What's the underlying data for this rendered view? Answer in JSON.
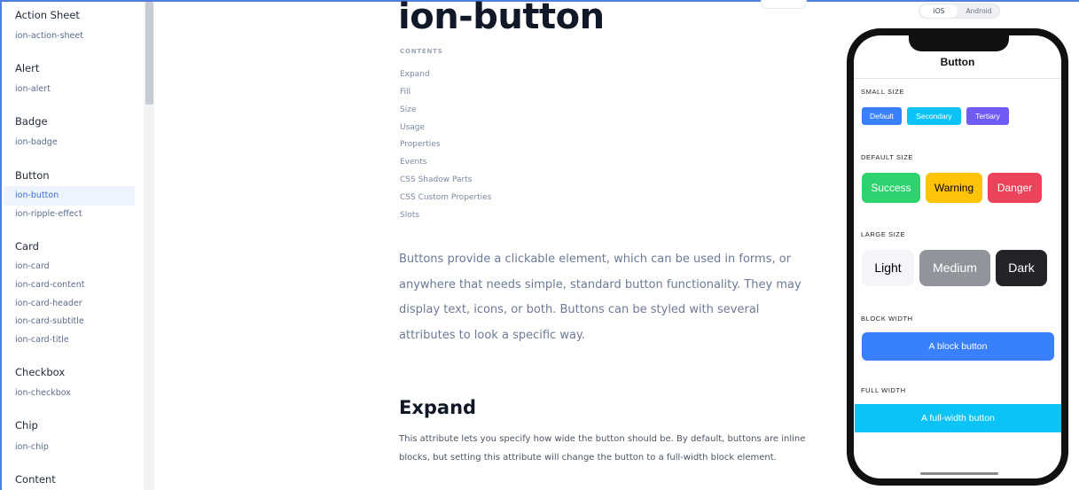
{
  "sidebar": {
    "groups": [
      {
        "title": "Action Sheet",
        "links": [
          "ion-action-sheet"
        ]
      },
      {
        "title": "Alert",
        "links": [
          "ion-alert"
        ]
      },
      {
        "title": "Badge",
        "links": [
          "ion-badge"
        ]
      },
      {
        "title": "Button",
        "links": [
          "ion-button",
          "ion-ripple-effect"
        ]
      },
      {
        "title": "Card",
        "links": [
          "ion-card",
          "ion-card-content",
          "ion-card-header",
          "ion-card-subtitle",
          "ion-card-title"
        ]
      },
      {
        "title": "Checkbox",
        "links": [
          "ion-checkbox"
        ]
      },
      {
        "title": "Chip",
        "links": [
          "ion-chip"
        ]
      },
      {
        "title": "Content",
        "links": []
      }
    ],
    "active_link": "ion-button"
  },
  "main": {
    "title": "ion-button",
    "contents_label": "CONTENTS",
    "toc": [
      "Expand",
      "Fill",
      "Size",
      "Usage",
      "Properties",
      "Events",
      "CSS Shadow Parts",
      "CSS Custom Properties",
      "Slots"
    ],
    "intro": "Buttons provide a clickable element, which can be used in forms, or anywhere that needs simple, standard button functionality. They may display text, icons, or both. Buttons can be styled with several attributes to look a specific way.",
    "expand_heading": "Expand",
    "expand_text": "This attribute lets you specify how wide the button should be. By default, buttons are inline blocks, but setting this attribute will change the button to a full-width block element."
  },
  "preview": {
    "platform_options": [
      "iOS",
      "Android"
    ],
    "selected_platform": "iOS",
    "title": "Button",
    "sections": {
      "small": "SMALL SIZE",
      "default": "DEFAULT SIZE",
      "large": "LARGE SIZE",
      "block": "BLOCK WIDTH",
      "full": "FULL WIDTH"
    },
    "small_buttons": [
      "Default",
      "Secondary",
      "Tertiary"
    ],
    "default_buttons": [
      "Success",
      "Warning",
      "Danger"
    ],
    "large_buttons": [
      "Light",
      "Medium",
      "Dark"
    ],
    "block_button": "A block button",
    "full_button": "A full-width button"
  },
  "colors": {
    "primary": "#3880ff",
    "secondary": "#0cc3f7",
    "tertiary": "#6f5cf6",
    "success": "#2dd36f",
    "warning": "#ffc409",
    "danger": "#eb445a",
    "light": "#f4f5f8",
    "medium": "#92949c",
    "dark": "#222428"
  }
}
